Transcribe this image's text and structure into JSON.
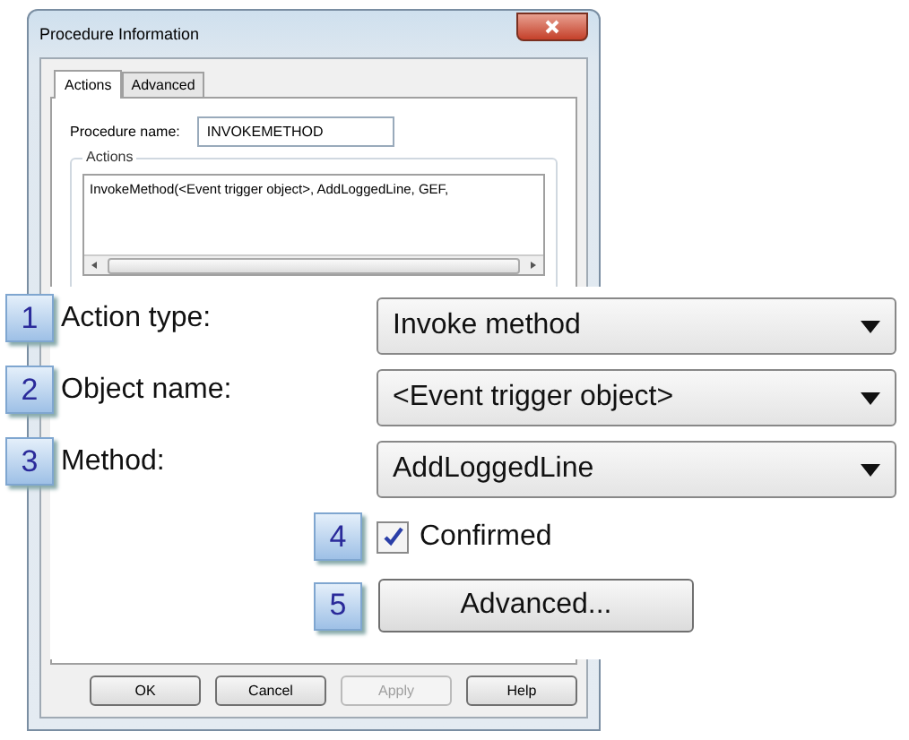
{
  "window": {
    "title": "Procedure Information"
  },
  "tabs": [
    {
      "label": "Actions",
      "selected": true
    },
    {
      "label": "Advanced",
      "selected": false
    }
  ],
  "procedure_name": {
    "label": "Procedure name:",
    "value": "INVOKEMETHOD"
  },
  "actions_group": {
    "title": "Actions",
    "items": [
      "InvokeMethod(<Event trigger object>, AddLoggedLine, GEF,"
    ]
  },
  "callout": {
    "fields": [
      {
        "number": "1",
        "label": "Action type:",
        "value": "Invoke method"
      },
      {
        "number": "2",
        "label": "Object name:",
        "value": "<Event trigger object>"
      },
      {
        "number": "3",
        "label": "Method:",
        "value": "AddLoggedLine"
      }
    ],
    "checkbox": {
      "number": "4",
      "label": "Confirmed",
      "checked": true
    },
    "button": {
      "number": "5",
      "label": "Advanced..."
    }
  },
  "buttons": [
    {
      "label": "OK",
      "disabled": false
    },
    {
      "label": "Cancel",
      "disabled": false
    },
    {
      "label": "Apply",
      "disabled": true
    },
    {
      "label": "Help",
      "disabled": false
    }
  ]
}
